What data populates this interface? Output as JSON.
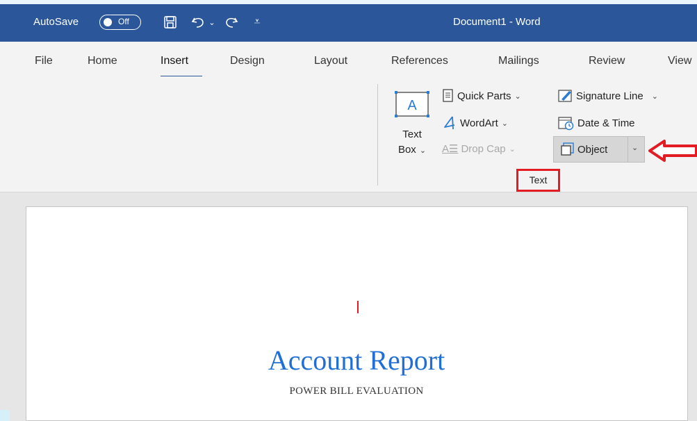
{
  "titlebar": {
    "autosave_label": "AutoSave",
    "toggle_state": "Off",
    "doc_title": "Document1 - Word",
    "background": "#2b579a",
    "icons": [
      "save-icon",
      "undo-icon",
      "redo-icon",
      "customize-quick-access-icon"
    ]
  },
  "tabs": [
    "File",
    "Home",
    "Insert",
    "Design",
    "Layout",
    "References",
    "Mailings",
    "Review",
    "View"
  ],
  "active_tab": "Insert",
  "ribbon": {
    "text_box": {
      "line1": "Text",
      "line2": "Box"
    },
    "quick_parts": "Quick Parts",
    "wordart": "WordArt",
    "drop_cap": "Drop Cap",
    "signature_line": "Signature Line",
    "date_time": "Date & Time",
    "object": "Object",
    "group_label": "Text"
  },
  "annotation_colors": {
    "highlight_box": "#e31b23",
    "arrow": "#e31b23"
  },
  "document": {
    "title": "Account Report",
    "subtitle": "POWER BILL EVALUATION",
    "title_color": "#1f6fd6"
  }
}
